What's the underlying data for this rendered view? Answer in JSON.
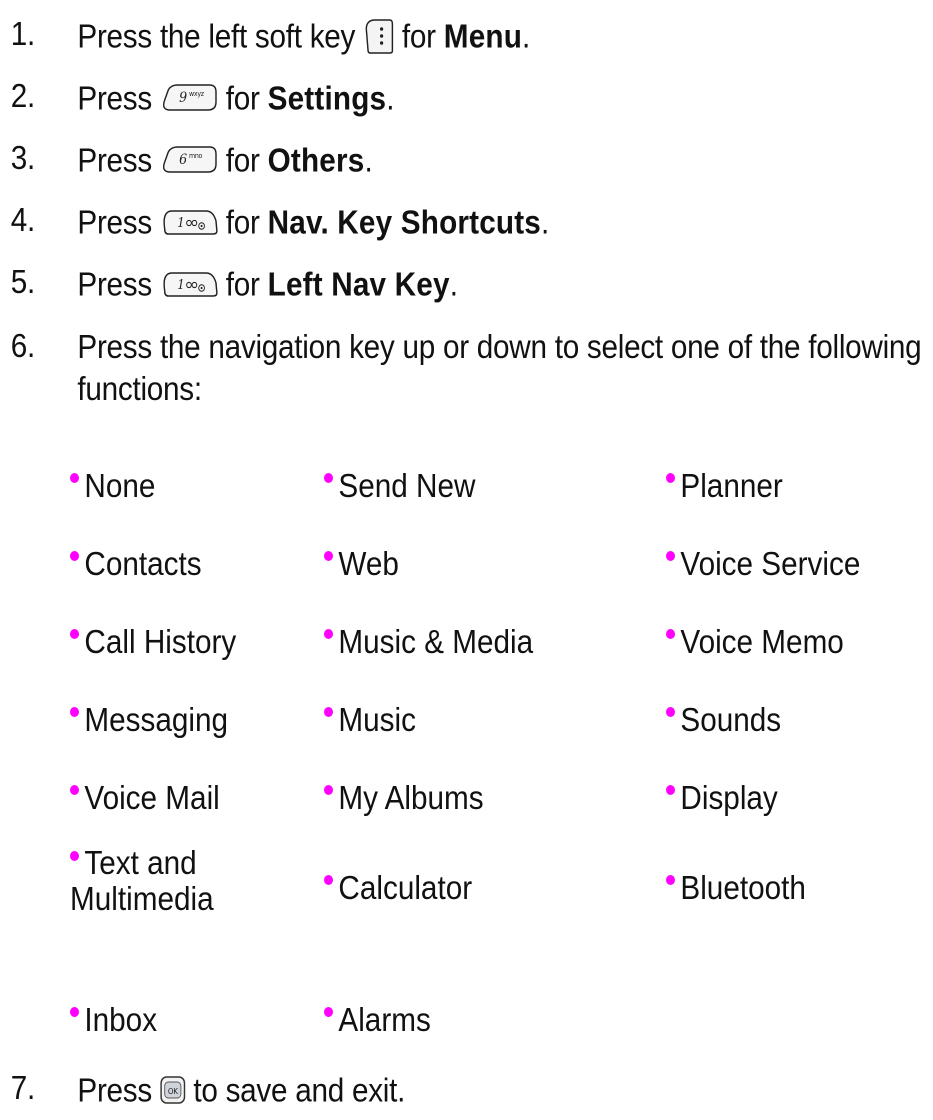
{
  "steps": [
    {
      "num": "1.",
      "pre": "Press the left soft key",
      "key": "left-soft-key-icon",
      "post": "for",
      "keyword": "Menu",
      "end": "."
    },
    {
      "num": "2.",
      "pre": "Press",
      "key": "key-9-wxyz-icon",
      "key_digit": "9",
      "key_letters": "wxyz",
      "post": "for",
      "keyword": "Settings",
      "end": "."
    },
    {
      "num": "3.",
      "pre": "Press",
      "key": "key-6-mno-icon",
      "key_digit": "6",
      "key_letters": "mno",
      "post": "for",
      "keyword": "Others",
      "end": "."
    },
    {
      "num": "4.",
      "pre": "Press",
      "key": "key-1-voicemail-icon",
      "key_digit": "1",
      "post": "for",
      "keyword": "Nav. Key Shortcuts",
      "end": "."
    },
    {
      "num": "5.",
      "pre": "Press",
      "key": "key-1-voicemail-icon",
      "key_digit": "1",
      "post": "for",
      "keyword": "Left Nav Key",
      "end": "."
    },
    {
      "num": "6.",
      "text": "Press the navigation key up or down to select one of the following functions:"
    },
    {
      "num": "7.",
      "pre": "Press",
      "key": "ok-key-icon",
      "key_label": "OK",
      "post": "to save and exit."
    }
  ],
  "functions": {
    "col1": [
      "None",
      "Contacts",
      "Call History",
      "Messaging",
      "Voice Mail",
      "Text and Multimedia",
      "Inbox"
    ],
    "col2": [
      "Send New",
      "Web",
      "Music & Media",
      "Music",
      "My Albums",
      "Calculator",
      "Alarms"
    ],
    "col3": [
      "Planner",
      "Voice Service",
      "Voice Memo",
      "Sounds",
      "Display",
      "Bluetooth"
    ]
  },
  "colors": {
    "bullet": "#ff00ff",
    "text": "#111111"
  }
}
